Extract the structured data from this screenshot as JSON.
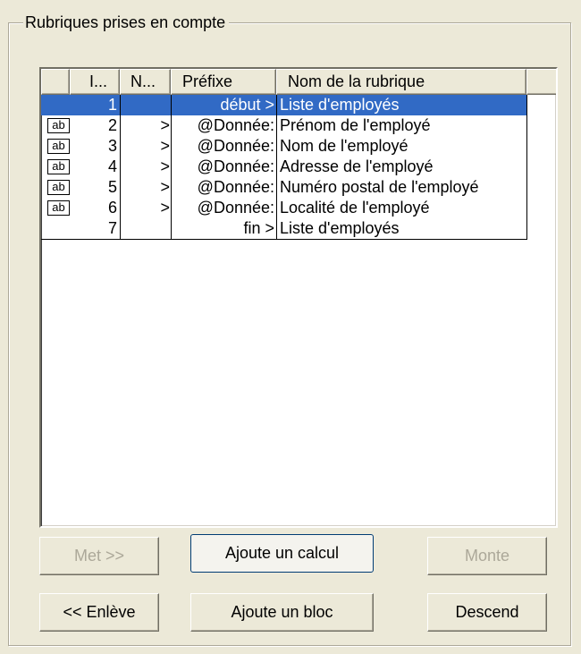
{
  "group": {
    "title": "Rubriques prises en compte"
  },
  "list": {
    "columns": [
      "",
      "I...",
      "N...",
      "Préfixe",
      "Nom de la rubrique",
      ""
    ],
    "rows": [
      {
        "icon": "",
        "index": "1",
        "n": "",
        "prefix": "début >",
        "name": "Liste d'employés",
        "selected": true
      },
      {
        "icon": "ab",
        "index": "2",
        "n": ">",
        "prefix": "@Donnée:",
        "name": "Prénom de l'employé",
        "selected": false
      },
      {
        "icon": "ab",
        "index": "3",
        "n": ">",
        "prefix": "@Donnée:",
        "name": "Nom de l'employé",
        "selected": false
      },
      {
        "icon": "ab",
        "index": "4",
        "n": ">",
        "prefix": "@Donnée:",
        "name": "Adresse de l'employé",
        "selected": false
      },
      {
        "icon": "ab",
        "index": "5",
        "n": ">",
        "prefix": "@Donnée:",
        "name": "Numéro postal de l'employé",
        "selected": false
      },
      {
        "icon": "ab",
        "index": "6",
        "n": ">",
        "prefix": "@Donnée:",
        "name": "Localité de l'employé",
        "selected": false
      },
      {
        "icon": "",
        "index": "7",
        "n": "",
        "prefix": "fin >",
        "name": "Liste d'employés",
        "selected": false
      }
    ]
  },
  "buttons": {
    "add": "Met >>",
    "add_calc": "Ajoute un calcul",
    "move_up": "Monte",
    "remove": "<< Enlève",
    "add_block": "Ajoute un bloc",
    "move_down": "Descend"
  },
  "colors": {
    "selection": "#316ac5",
    "face": "#ece9d8",
    "disabled_text": "#aca899"
  }
}
